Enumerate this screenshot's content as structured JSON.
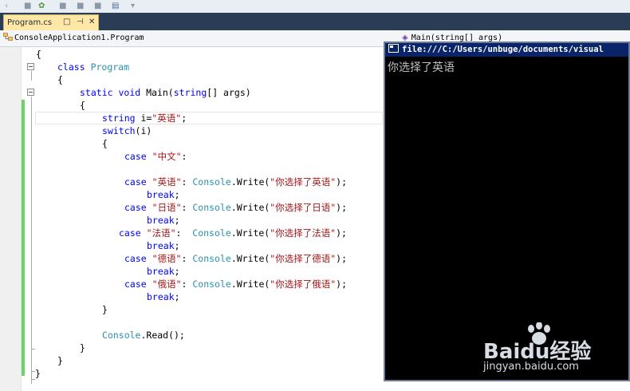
{
  "tab": {
    "label": "Program.cs",
    "pin": "⊓",
    "close": "✕",
    "lock": "□"
  },
  "navbar": {
    "class_dropdown": "ConsoleApplication1.Program",
    "method_dropdown": "Main(string[] args)"
  },
  "code_lines": [
    {
      "tokens": [
        {
          "text": "{",
          "c": ""
        }
      ]
    },
    {
      "tokens": [
        {
          "text": "class",
          "c": "kw"
        },
        {
          "text": " ",
          "c": ""
        },
        {
          "text": "Program",
          "c": "ty"
        }
      ]
    },
    {
      "tokens": [
        {
          "text": "{",
          "c": ""
        }
      ]
    },
    {
      "tokens": [
        {
          "text": "static",
          "c": "kw"
        },
        {
          "text": " ",
          "c": ""
        },
        {
          "text": "void",
          "c": "kw"
        },
        {
          "text": " Main(",
          "c": ""
        },
        {
          "text": "string",
          "c": "kw"
        },
        {
          "text": "[] args)",
          "c": ""
        }
      ]
    },
    {
      "tokens": [
        {
          "text": "{",
          "c": ""
        }
      ]
    },
    {
      "tokens": [
        {
          "text": "string",
          "c": "kw"
        },
        {
          "text": " i=",
          "c": ""
        },
        {
          "text": "\"英语\"",
          "c": "str"
        },
        {
          "text": ";",
          "c": ""
        }
      ]
    },
    {
      "tokens": [
        {
          "text": "switch",
          "c": "kw"
        },
        {
          "text": "(i)",
          "c": ""
        }
      ]
    },
    {
      "tokens": [
        {
          "text": "{",
          "c": ""
        }
      ]
    },
    {
      "tokens": [
        {
          "text": "case",
          "c": "kw"
        },
        {
          "text": " ",
          "c": ""
        },
        {
          "text": "\"中文\"",
          "c": "str"
        },
        {
          "text": ":",
          "c": ""
        }
      ]
    },
    {
      "tokens": []
    },
    {
      "tokens": [
        {
          "text": "case",
          "c": "kw"
        },
        {
          "text": " ",
          "c": ""
        },
        {
          "text": "\"英语\"",
          "c": "str"
        },
        {
          "text": ": ",
          "c": ""
        },
        {
          "text": "Console",
          "c": "ty"
        },
        {
          "text": ".Write(",
          "c": ""
        },
        {
          "text": "\"你选择了英语\"",
          "c": "str"
        },
        {
          "text": ");",
          "c": ""
        }
      ]
    },
    {
      "tokens": [
        {
          "text": "break",
          "c": "kw"
        },
        {
          "text": ";",
          "c": ""
        }
      ]
    },
    {
      "tokens": [
        {
          "text": "case",
          "c": "kw"
        },
        {
          "text": " ",
          "c": ""
        },
        {
          "text": "\"日语\"",
          "c": "str"
        },
        {
          "text": ": ",
          "c": ""
        },
        {
          "text": "Console",
          "c": "ty"
        },
        {
          "text": ".Write(",
          "c": ""
        },
        {
          "text": "\"你选择了日语\"",
          "c": "str"
        },
        {
          "text": ");",
          "c": ""
        }
      ]
    },
    {
      "tokens": [
        {
          "text": "break",
          "c": "kw"
        },
        {
          "text": ";",
          "c": ""
        }
      ]
    },
    {
      "tokens": [
        {
          "text": "case",
          "c": "kw"
        },
        {
          "text": " ",
          "c": ""
        },
        {
          "text": "\"法语\"",
          "c": "str"
        },
        {
          "text": ":  ",
          "c": ""
        },
        {
          "text": "Console",
          "c": "ty"
        },
        {
          "text": ".Write(",
          "c": ""
        },
        {
          "text": "\"你选择了法语\"",
          "c": "str"
        },
        {
          "text": ");",
          "c": ""
        }
      ]
    },
    {
      "tokens": [
        {
          "text": "break",
          "c": "kw"
        },
        {
          "text": ";",
          "c": ""
        }
      ]
    },
    {
      "tokens": [
        {
          "text": "case",
          "c": "kw"
        },
        {
          "text": " ",
          "c": ""
        },
        {
          "text": "\"德语\"",
          "c": "str"
        },
        {
          "text": ": ",
          "c": ""
        },
        {
          "text": "Console",
          "c": "ty"
        },
        {
          "text": ".Write(",
          "c": ""
        },
        {
          "text": "\"你选择了德语\"",
          "c": "str"
        },
        {
          "text": ");",
          "c": ""
        }
      ]
    },
    {
      "tokens": [
        {
          "text": "break",
          "c": "kw"
        },
        {
          "text": ";",
          "c": ""
        }
      ]
    },
    {
      "tokens": [
        {
          "text": "case",
          "c": "kw"
        },
        {
          "text": " ",
          "c": ""
        },
        {
          "text": "\"俄语\"",
          "c": "str"
        },
        {
          "text": ": ",
          "c": ""
        },
        {
          "text": "Console",
          "c": "ty"
        },
        {
          "text": ".Write(",
          "c": ""
        },
        {
          "text": "\"你选择了俄语\"",
          "c": "str"
        },
        {
          "text": ");",
          "c": ""
        }
      ]
    },
    {
      "tokens": [
        {
          "text": "break",
          "c": "kw"
        },
        {
          "text": ";",
          "c": ""
        }
      ]
    },
    {
      "tokens": [
        {
          "text": "}",
          "c": ""
        }
      ]
    },
    {
      "tokens": []
    },
    {
      "tokens": [
        {
          "text": "Console",
          "c": "ty"
        },
        {
          "text": ".Read();",
          "c": ""
        }
      ]
    },
    {
      "tokens": [
        {
          "text": "}",
          "c": ""
        }
      ]
    },
    {
      "tokens": [
        {
          "text": "}",
          "c": ""
        }
      ]
    },
    {
      "tokens": [
        {
          "text": "}",
          "c": ""
        }
      ]
    }
  ],
  "console": {
    "title": "file:///C:/Users/unbuge/documents/visual",
    "output": "你选择了英语"
  },
  "watermark": {
    "logo": "Baidu经验",
    "url": "jingyan.baidu.com"
  }
}
